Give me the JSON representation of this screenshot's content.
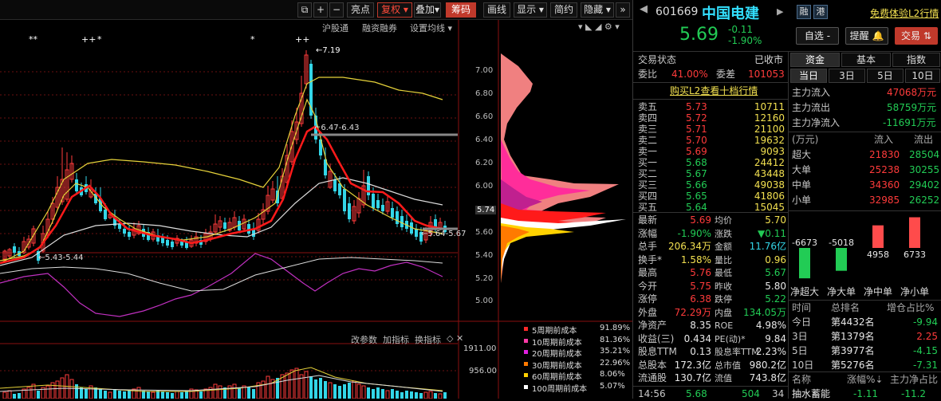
{
  "toolbar": {
    "btn_a": "亮点",
    "btn_fq": "复权",
    "btn_dj": "叠加",
    "btn_cm": "筹码",
    "btn_hx": "画线",
    "btn_xs": "显示",
    "btn_jy": "简约",
    "btn_yc": "隐藏"
  },
  "chart": {
    "sub_links": [
      "沪股通",
      "融资融券",
      "设置均线"
    ],
    "price_axis": [
      "7.00",
      "6.80",
      "6.60",
      "6.40",
      "6.20",
      "6.00",
      "5.74",
      "5.60",
      "5.40",
      "5.20",
      "5.00"
    ],
    "annot_high": "7.19",
    "annot_mid": "6.47-6.43",
    "annot_low": "5.43-5.44",
    "annot_right": "5.64-5.67",
    "vol_links": [
      "改参数",
      "加指标",
      "换指标"
    ],
    "vol_axis": [
      "1911.00",
      "956.00"
    ],
    "vol_ticks": [
      "**",
      "++",
      "*",
      "*",
      "++"
    ],
    "chip_legend": [
      {
        "label": "5周期前成本",
        "pct": "91.89%",
        "color": "#ff2a2a"
      },
      {
        "label": "10周期前成本",
        "pct": "81.36%",
        "color": "#ff3aa8"
      },
      {
        "label": "20周期前成本",
        "pct": "35.21%",
        "color": "#e020e0"
      },
      {
        "label": "30周期前成本",
        "pct": "22.96%",
        "color": "#ff7a00"
      },
      {
        "label": "60周期前成本",
        "pct": "8.06%",
        "color": "#ffd000"
      },
      {
        "label": "100周期前成本",
        "pct": "5.07%",
        "color": "#ffffff"
      }
    ]
  },
  "quote": {
    "code": "601669",
    "name": "中国电建",
    "badge1": "融",
    "badge2": "港",
    "free_link": "免费体验L2行情",
    "price": "5.69",
    "change": "-0.11",
    "pct": "-1.90%",
    "btn_watch": "自选 -",
    "btn_alert": "提醒",
    "btn_trade": "交易",
    "status_label": "交易状态",
    "status_value": "已收市",
    "weibi_label": "委比",
    "weibi": "41.00%",
    "weicha_label": "委差",
    "weicha": "101053",
    "l2_link": "购买L2查看十档行情",
    "asks": [
      {
        "label": "卖五",
        "price": "5.73",
        "vol": "10711"
      },
      {
        "label": "卖四",
        "price": "5.72",
        "vol": "12160"
      },
      {
        "label": "卖三",
        "price": "5.71",
        "vol": "21100"
      },
      {
        "label": "卖二",
        "price": "5.70",
        "vol": "19632"
      },
      {
        "label": "卖一",
        "price": "5.69",
        "vol": "9093"
      }
    ],
    "bids": [
      {
        "label": "买一",
        "price": "5.68",
        "vol": "24412"
      },
      {
        "label": "买二",
        "price": "5.67",
        "vol": "43448"
      },
      {
        "label": "买三",
        "price": "5.66",
        "vol": "49038"
      },
      {
        "label": "买四",
        "price": "5.65",
        "vol": "41806"
      },
      {
        "label": "买五",
        "price": "5.64",
        "vol": "15045"
      }
    ],
    "stats": [
      {
        "l1": "最新",
        "v1": "5.69",
        "c1": "red",
        "l2": "均价",
        "v2": "5.70",
        "c2": "yel"
      },
      {
        "l1": "涨幅",
        "v1": "-1.90%",
        "c1": "green",
        "l2": "涨跌",
        "v2": "▼0.11",
        "c2": "green"
      },
      {
        "l1": "总手",
        "v1": "206.34万",
        "c1": "yel",
        "l2": "金额",
        "v2": "11.76亿",
        "c2": "cy"
      },
      {
        "l1": "换手*",
        "v1": "1.58%",
        "c1": "yel",
        "l2": "量比",
        "v2": "0.96",
        "c2": "yel"
      },
      {
        "l1": "最高",
        "v1": "5.76",
        "c1": "red",
        "l2": "最低",
        "v2": "5.67",
        "c2": "green"
      },
      {
        "l1": "今开",
        "v1": "5.75",
        "c1": "red",
        "l2": "昨收",
        "v2": "5.80",
        "c2": "wht"
      },
      {
        "l1": "涨停",
        "v1": "6.38",
        "c1": "red",
        "l2": "跌停",
        "v2": "5.22",
        "c2": "green"
      },
      {
        "l1": "外盘",
        "v1": "72.29万",
        "c1": "red",
        "l2": "内盘",
        "v2": "134.05万",
        "c2": "green"
      },
      {
        "l1": "净资产",
        "v1": "8.35",
        "c1": "wht",
        "l2": "ROE",
        "v2": "4.98%",
        "c2": "wht"
      },
      {
        "l1": "收益(三)",
        "v1": "0.434",
        "c1": "wht",
        "l2": "PE(动)*",
        "v2": "9.84",
        "c2": "wht"
      },
      {
        "l1": "股息TTM",
        "v1": "0.13",
        "c1": "wht",
        "l2": "股息率TTM",
        "v2": "2.23%",
        "c2": "wht"
      },
      {
        "l1": "总股本",
        "v1": "172.3亿",
        "c1": "wht",
        "l2": "总市值",
        "v2": "980.2亿",
        "c2": "wht"
      },
      {
        "l1": "流通股",
        "v1": "130.7亿",
        "c1": "wht",
        "l2": "流值",
        "v2": "743.8亿",
        "c2": "wht"
      }
    ],
    "tick": {
      "time": "14:56",
      "price": "5.68",
      "vol": "504",
      "num": "34"
    }
  },
  "fund": {
    "tabs": [
      "资金",
      "基本",
      "指数"
    ],
    "period_tabs": [
      "当日",
      "3日",
      "5日",
      "10日"
    ],
    "main_in_label": "主力流入",
    "main_in": "47068万元",
    "main_out_label": "主力流出",
    "main_out": "58759万元",
    "main_net_label": "主力净流入",
    "main_net": "-11691万元",
    "table_head": [
      "(万元)",
      "流入",
      "流出"
    ],
    "table": [
      {
        "k": "超大",
        "in": "21830",
        "out": "28504"
      },
      {
        "k": "大单",
        "in": "25238",
        "out": "30255"
      },
      {
        "k": "中单",
        "in": "34360",
        "out": "29402"
      },
      {
        "k": "小单",
        "in": "32985",
        "out": "26252"
      }
    ],
    "bars": [
      {
        "label": "净超大",
        "value": "-6673"
      },
      {
        "label": "净大单",
        "value": "-5018"
      },
      {
        "label": "净中单",
        "value": "4958"
      },
      {
        "label": "净小单",
        "value": "6733"
      }
    ],
    "rank_head": [
      "时间",
      "总排名",
      "增仓占比%"
    ],
    "rank": [
      {
        "t": "今日",
        "r": "第4432名",
        "p": "-9.94"
      },
      {
        "t": "3日",
        "r": "第1379名",
        "p": "2.25"
      },
      {
        "t": "5日",
        "r": "第3977名",
        "p": "-4.15"
      },
      {
        "t": "10日",
        "r": "第5276名",
        "p": "-7.31"
      }
    ],
    "list_head": [
      "名称",
      "涨幅%",
      "主力净占比"
    ],
    "list_first": {
      "name": "抽水蓄能",
      "pct": "-1.11",
      "net": "-11.2"
    }
  }
}
